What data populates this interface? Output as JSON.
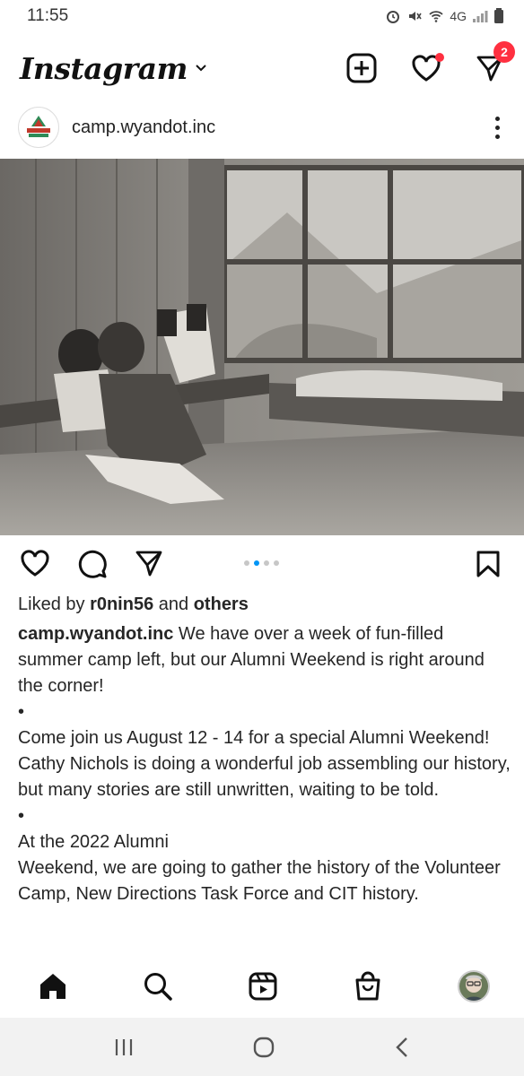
{
  "status_bar": {
    "time": "11:55",
    "network": "4G",
    "icons": [
      "alarm-icon",
      "mute-icon",
      "wifi-icon",
      "signal-icon",
      "battery-icon"
    ]
  },
  "header": {
    "logo": "Instagram",
    "dropdown_icon": "chevron-down-icon",
    "actions": [
      "new-post-icon",
      "heart-icon",
      "direct-message-icon"
    ],
    "message_badge": "2",
    "accent_color": "#ff3040"
  },
  "post": {
    "account": "camp.wyandot.inc",
    "avatar_label": "CAMP WYANDOT",
    "photo_description_icon": "photo",
    "carousel": {
      "count": 4,
      "active_index": 1,
      "active_color": "#0095f6"
    },
    "likes": {
      "prefix": "Liked by",
      "user": "r0nin56",
      "connector": "and",
      "others": "others"
    },
    "caption": {
      "user": "camp.wyandot.inc",
      "lines": [
        " We have over a week of fun-filled summer camp left, but our Alumni Weekend is right around the corner!",
        "•",
        "Come join us August 12 - 14 for a special Alumni Weekend! Cathy Nichols is doing a wonderful job assembling our history, but many stories are still unwritten, waiting to be told.",
        "•",
        "At the 2022 Alumni",
        "Weekend, we are going to gather the history of the Volunteer Camp, New Directions Task Force and CIT history."
      ]
    }
  },
  "bottom_nav": {
    "items": [
      "home-icon",
      "search-icon",
      "reels-icon",
      "shop-icon",
      "profile-avatar"
    ]
  },
  "system_nav": {
    "items": [
      "recent-apps-icon",
      "home-circle-icon",
      "back-icon"
    ]
  }
}
